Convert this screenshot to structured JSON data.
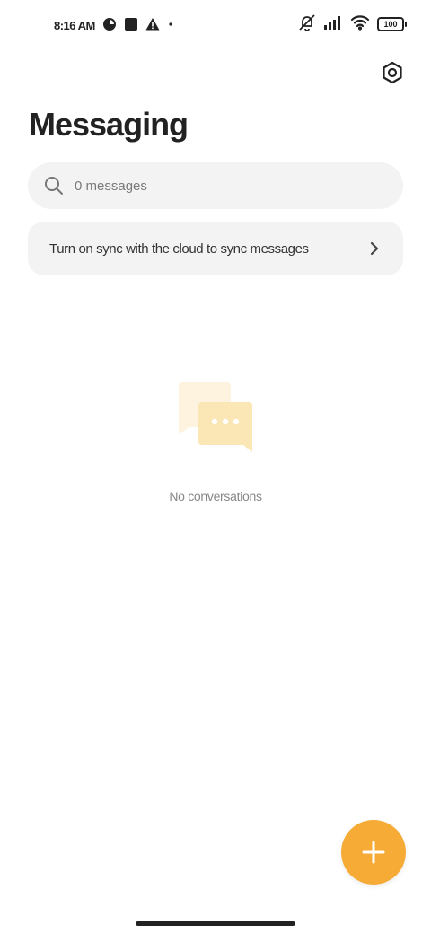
{
  "status_bar": {
    "time": "8:16 AM",
    "left_icons": [
      "pie-chart-icon",
      "square-app-icon",
      "alert-triangle-icon",
      "dot-icon"
    ],
    "right_icons": [
      "silent-mode-icon",
      "signal-icon",
      "wifi-icon"
    ],
    "battery": "100"
  },
  "header": {
    "title": "Messaging",
    "settings_icon": "settings-hexagon-icon"
  },
  "search": {
    "placeholder": "0 messages",
    "icon": "search-icon"
  },
  "sync_banner": {
    "text": "Turn on sync with the cloud to sync messages",
    "icon": "chevron-right-icon"
  },
  "empty_state": {
    "icon": "chat-bubbles-icon",
    "label": "No conversations"
  },
  "fab": {
    "icon": "plus-icon",
    "color": "#f6ab37"
  },
  "colors": {
    "accent": "#f6ab37",
    "surface": "#f3f3f3",
    "text_primary": "#222222",
    "text_muted": "#888888",
    "bubble_light": "#fdf3de",
    "bubble_dark": "#fbe6b6"
  }
}
